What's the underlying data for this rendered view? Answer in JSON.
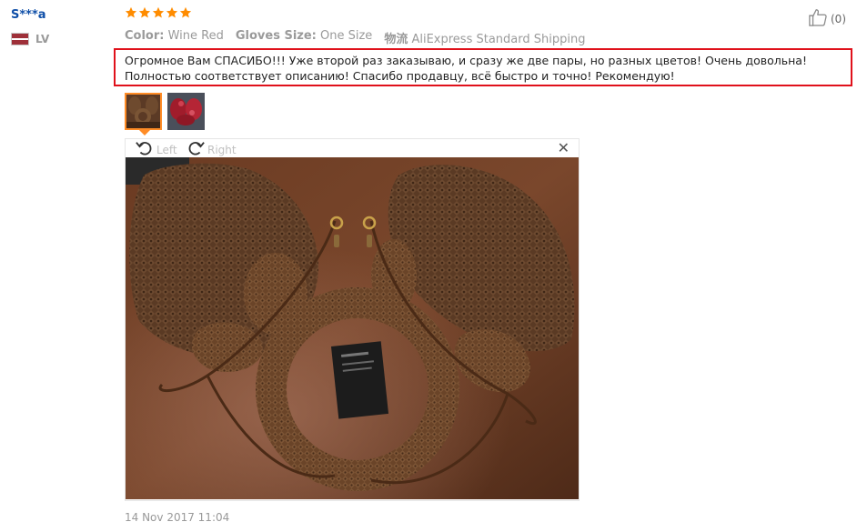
{
  "review": {
    "user": {
      "name": "S***a",
      "country_code": "LV"
    },
    "rating": {
      "stars": 5,
      "max": 5
    },
    "helpful": {
      "count": "(0)"
    },
    "attributes": [
      {
        "key": "Color:",
        "value": "Wine Red"
      },
      {
        "key": "Gloves Size:",
        "value": "One Size"
      },
      {
        "key": "物流",
        "value": "AliExpress Standard Shipping"
      }
    ],
    "text": "Огромное Вам СПАСИБО!!! Уже второй раз заказываю, и сразу же две пары, но разных цветов! Очень довольна! Полностью соответствует описанию! Спасибо продавцу, всё быстро и точно! Рекомендую!",
    "viewer": {
      "rotate_left": "Left",
      "rotate_right": "Right"
    },
    "date": "14 Nov 2017 11:04"
  },
  "colors": {
    "username": "#0f4fa8",
    "star": "#ff8c00",
    "highlight_border": "#e0111b",
    "active_thumb": "#ff8c26"
  }
}
